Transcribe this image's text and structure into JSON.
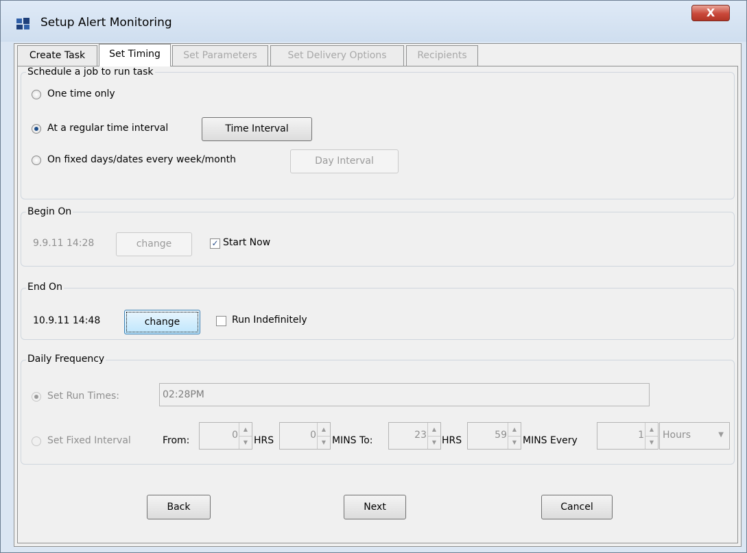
{
  "window": {
    "title": "Setup Alert Monitoring",
    "close_label": "X"
  },
  "tabs": [
    {
      "label": "Create Task",
      "state": "normal"
    },
    {
      "label": "Set Timing",
      "state": "active"
    },
    {
      "label": "Set Parameters",
      "state": "disabled"
    },
    {
      "label": "Set Delivery Options",
      "state": "disabled"
    },
    {
      "label": "Recipients",
      "state": "disabled"
    }
  ],
  "schedule": {
    "title": "Schedule a job to run task",
    "option_one_time": "One time only",
    "option_regular": "At a regular time interval",
    "time_interval_button": "Time Interval",
    "option_fixed_days": "On fixed days/dates every week/month",
    "day_interval_button": "Day Interval",
    "selected": "regular"
  },
  "begin_on": {
    "title": "Begin On",
    "date": "9.9.11 14:28",
    "change_button": "change",
    "start_now_label": "Start Now",
    "start_now_checked": true
  },
  "end_on": {
    "title": "End On",
    "date": "10.9.11 14:48",
    "change_button": "change",
    "run_indef_label": "Run Indefinitely",
    "run_indef_checked": false
  },
  "daily_frequency": {
    "title": "Daily Frequency",
    "set_run_times_label": "Set Run Times:",
    "run_time_value": "02:28PM",
    "set_fixed_interval_label": "Set Fixed Interval",
    "from_label": "From:",
    "from_hrs": "0",
    "hrs_label": "HRS",
    "from_mins": "0",
    "mins_to_label": "MINS To:",
    "to_hrs": "23",
    "hrs_label2": "HRS",
    "to_mins": "59",
    "mins_every_label": "MINS Every",
    "every_value": "1",
    "unit_value": "Hours"
  },
  "footer": {
    "back": "Back",
    "next": "Next",
    "cancel": "Cancel"
  },
  "colors": {
    "title_bg": "#dfeaf7",
    "close_red": "#c9483a",
    "focus_blue": "#bee6fd"
  }
}
